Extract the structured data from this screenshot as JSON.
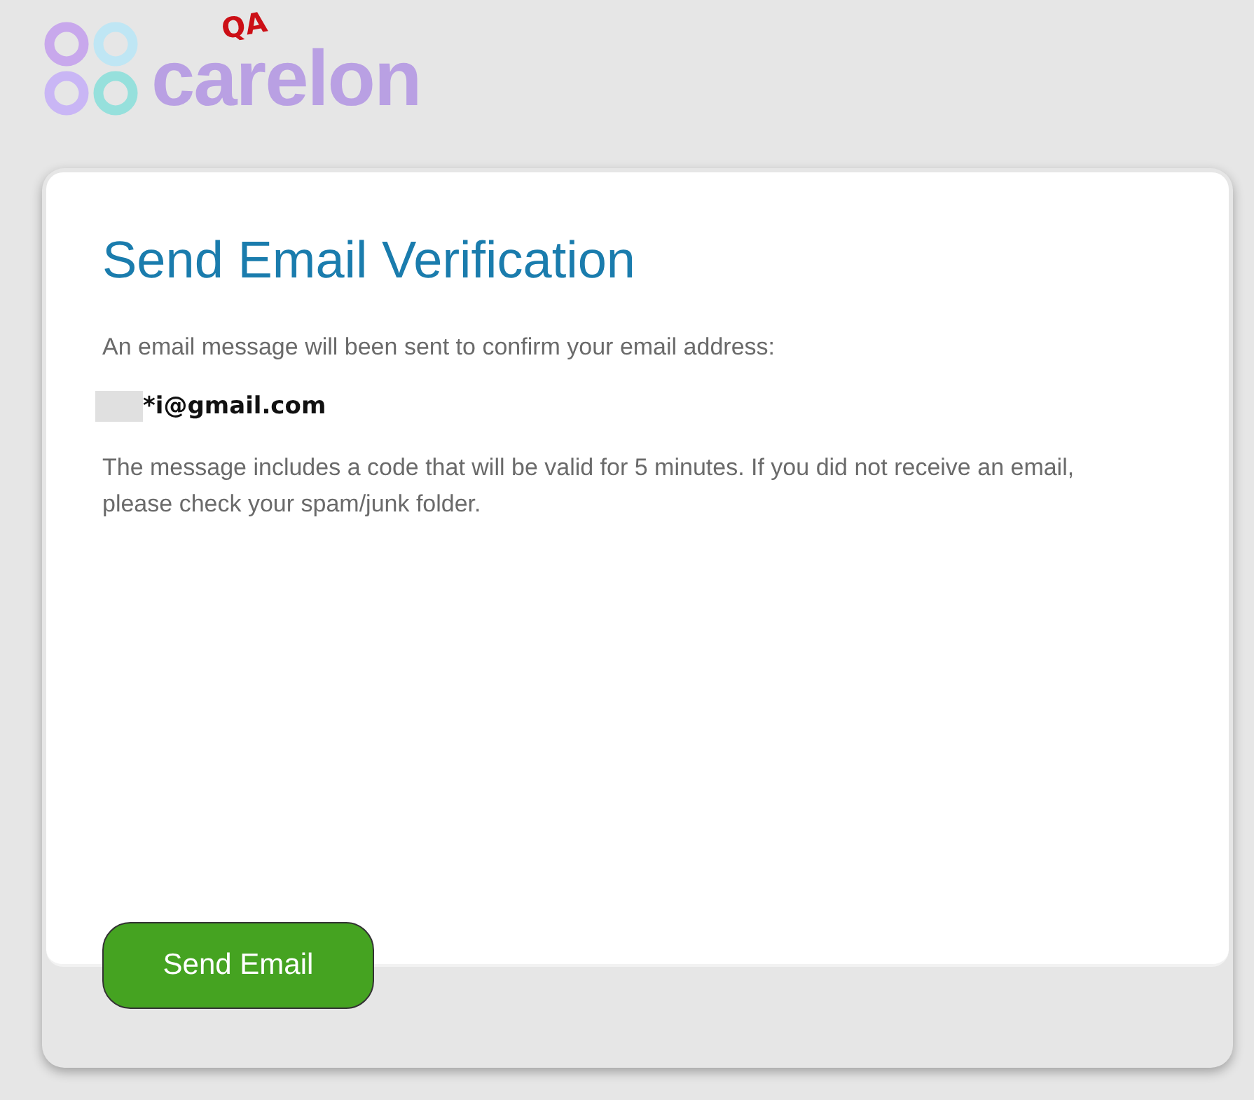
{
  "logo": {
    "wordmark": "carelon",
    "stamp": "QA"
  },
  "card": {
    "title": "Send Email Verification",
    "intro": "An email message will been sent to confirm your email address:",
    "email": "*i@gmail.com",
    "note": "The message includes a code that will be valid for 5 minutes. If you did not receive an email, please check your spam/junk folder."
  },
  "buttons": [
    {
      "label": "Send Email",
      "kind": "primary"
    }
  ]
}
